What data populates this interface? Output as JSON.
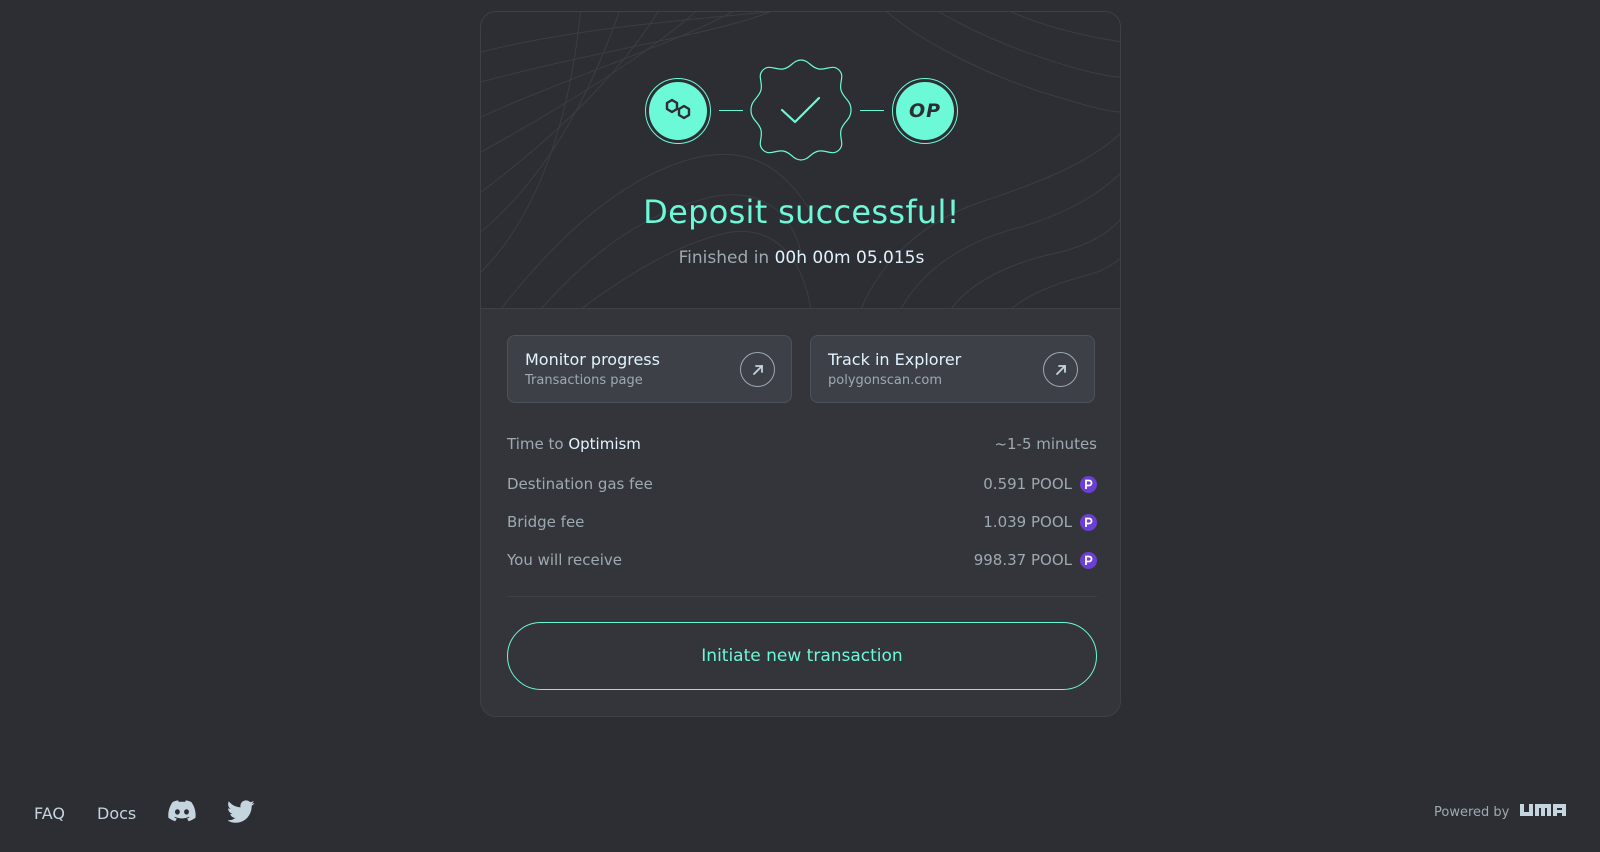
{
  "status": {
    "title": "Deposit successful!",
    "finished_prefix": "Finished in",
    "finished_time": "00h 00m 05.015s",
    "source_chain_icon": "polygon-icon",
    "destination_chain_label": "OP",
    "success_icon": "checkmark-seal-icon"
  },
  "links": [
    {
      "title": "Monitor progress",
      "subtitle": "Transactions page",
      "icon": "arrow-up-right-icon"
    },
    {
      "title": "Track in Explorer",
      "subtitle": "polygonscan.com",
      "icon": "arrow-up-right-icon"
    }
  ],
  "details": {
    "time": {
      "label_prefix": "Time to",
      "label_chain": "Optimism",
      "value": "~1-5 minutes"
    },
    "gas_fee": {
      "label": "Destination gas fee",
      "value": "0.591 POOL",
      "token_icon": "pooltogether-icon"
    },
    "bridge_fee": {
      "label": "Bridge fee",
      "value": "1.039 POOL",
      "token_icon": "pooltogether-icon"
    },
    "receive": {
      "label": "You will receive",
      "value": "998.37 POOL",
      "token_icon": "pooltogether-icon"
    }
  },
  "cta": {
    "label": "Initiate new transaction"
  },
  "footer": {
    "faq": "FAQ",
    "docs": "Docs",
    "discord_icon": "discord-icon",
    "twitter_icon": "twitter-icon",
    "powered_by": "Powered by",
    "brand": "UMA"
  },
  "colors": {
    "background": "#2d2e33",
    "card": "#34353b",
    "accent": "#6cf9d8",
    "muted_text": "#9daab2",
    "token_purple": "#6b3fd6"
  }
}
